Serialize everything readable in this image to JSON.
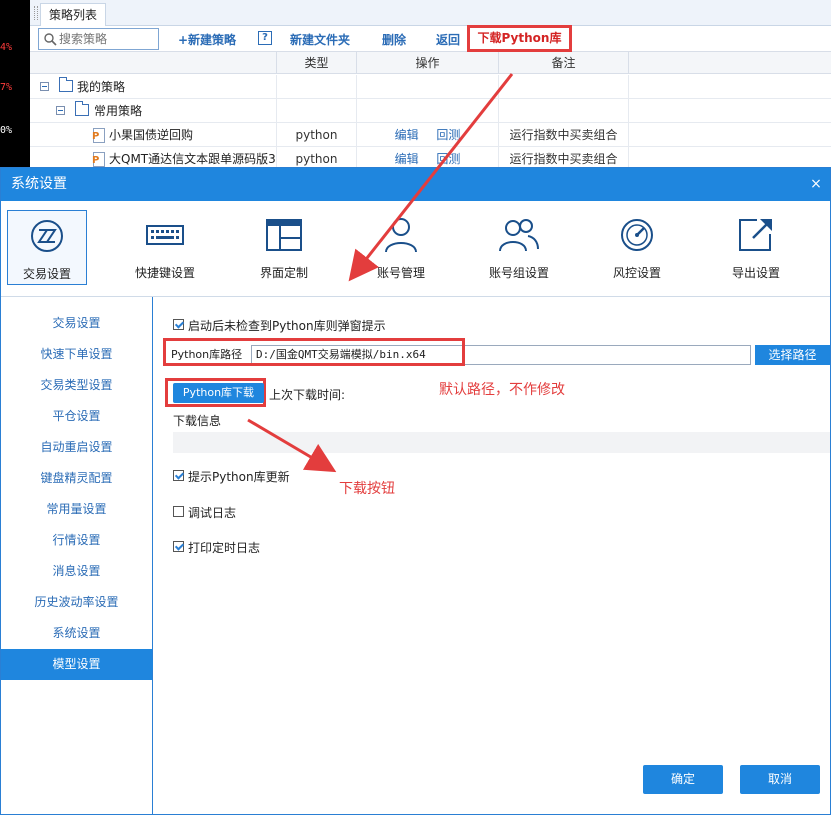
{
  "background_window": {
    "left_strip_values": [
      "4%",
      "7%",
      "0%"
    ],
    "tab_label": "策略列表",
    "search": {
      "placeholder": "搜索策略"
    },
    "toolbar": {
      "new_strategy": "+新建策略",
      "help": "?",
      "new_folder": "新建文件夹",
      "delete": "删除",
      "back": "返回",
      "download_python_lib": "下载Python库"
    },
    "columns": [
      "类型",
      "操作",
      "备注"
    ],
    "tree": [
      {
        "name": "我的策略",
        "level": 0,
        "kind": "folder",
        "type": "",
        "actions": [],
        "note": ""
      },
      {
        "name": "常用策略",
        "level": 1,
        "kind": "folder",
        "type": "",
        "actions": [],
        "note": ""
      },
      {
        "name": "小果国债逆回购",
        "level": 2,
        "kind": "file",
        "type": "python",
        "actions": [
          "编辑",
          "回测"
        ],
        "note": "运行指数中买卖组合"
      },
      {
        "name": "大QMT通达信文本跟单源码版3",
        "level": 2,
        "kind": "file",
        "type": "python",
        "actions": [
          "编辑",
          "回测"
        ],
        "note": "运行指数中买卖组合"
      }
    ]
  },
  "dialog": {
    "title": "系统设置",
    "close": "×",
    "categories": [
      {
        "label": "交易设置",
        "icon": "trade-settings-icon",
        "active": true
      },
      {
        "label": "快捷键设置",
        "icon": "keyboard-icon",
        "active": false
      },
      {
        "label": "界面定制",
        "icon": "layout-icon",
        "active": false
      },
      {
        "label": "账号管理",
        "icon": "user-icon",
        "active": false
      },
      {
        "label": "账号组设置",
        "icon": "user-group-icon",
        "active": false
      },
      {
        "label": "风控设置",
        "icon": "gauge-icon",
        "active": false
      },
      {
        "label": "导出设置",
        "icon": "export-icon",
        "active": false
      }
    ],
    "sidebar": [
      {
        "label": "交易设置",
        "active": false
      },
      {
        "label": "快速下单设置",
        "active": false
      },
      {
        "label": "交易类型设置",
        "active": false
      },
      {
        "label": "平仓设置",
        "active": false
      },
      {
        "label": "自动重启设置",
        "active": false
      },
      {
        "label": "键盘精灵配置",
        "active": false
      },
      {
        "label": "常用量设置",
        "active": false
      },
      {
        "label": "行情设置",
        "active": false
      },
      {
        "label": "消息设置",
        "active": false
      },
      {
        "label": "历史波动率设置",
        "active": false
      },
      {
        "label": "系统设置",
        "active": false
      },
      {
        "label": "模型设置",
        "active": true
      }
    ],
    "model_settings": {
      "popup_on_missing": {
        "label": "启动后未检查到Python库则弹窗提示",
        "checked": true
      },
      "path_label": "Python库路径",
      "path_value": "D:/国金QMT交易端模拟/bin.x64",
      "select_path": "选择路径",
      "download_button": "Python库下载",
      "last_download": "上次下载时间:",
      "download_info": "下载信息",
      "prompt_update": {
        "label": "提示Python库更新",
        "checked": true
      },
      "debug_log": {
        "label": "调试日志",
        "checked": false
      },
      "print_timer_log": {
        "label": "打印定时日志",
        "checked": true
      }
    },
    "ok": "确定",
    "cancel": "取消"
  },
  "annotations": {
    "default_path_note": "默认路径，不作修改",
    "download_button_note": "下载按钮",
    "color": "#e33d3d"
  },
  "colors": {
    "accent": "#1f86de",
    "link": "#2b6cb6",
    "annotation": "#e33d3d"
  }
}
